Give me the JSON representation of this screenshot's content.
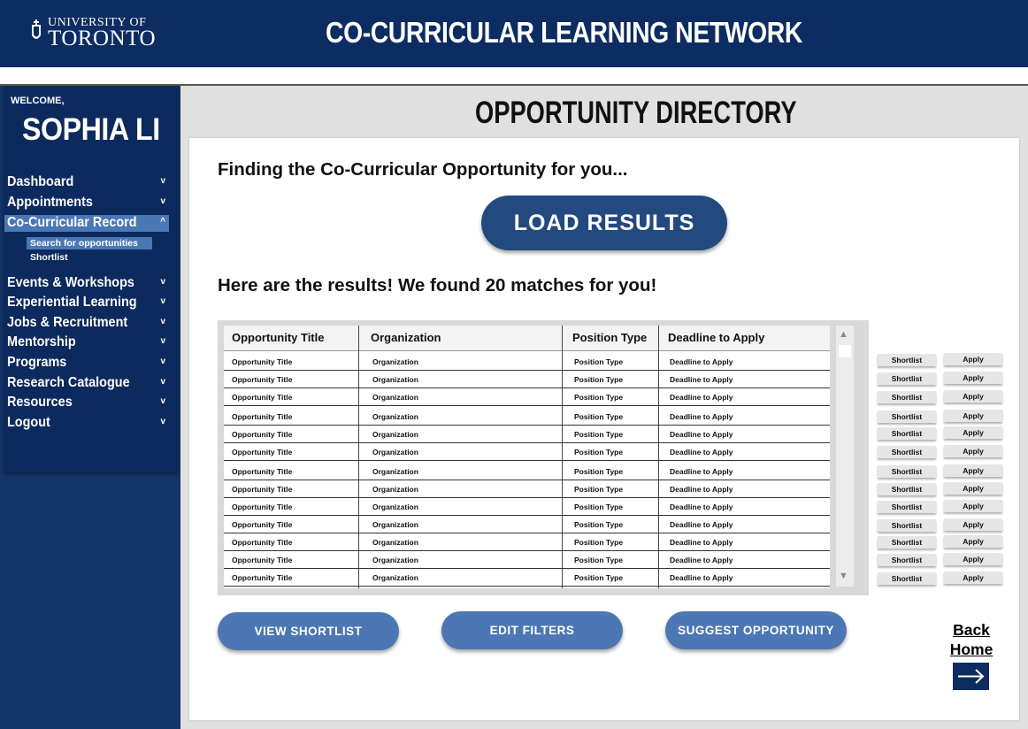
{
  "header": {
    "logo_line1": "UNIVERSITY OF",
    "logo_line2": "TORONTO",
    "title": "CO-CURRICULAR LEARNING NETWORK"
  },
  "sidebar": {
    "welcome": "WELCOME,",
    "user_name": "SOPHIA LI",
    "items": [
      {
        "label": "Dashboard",
        "chevron": "v"
      },
      {
        "label": "Appointments",
        "chevron": "v"
      },
      {
        "label": "Co-Curricular Record",
        "chevron": "^",
        "active": true
      },
      {
        "label": "Events & Workshops",
        "chevron": "v"
      },
      {
        "label": "Experiential Learning",
        "chevron": "v"
      },
      {
        "label": "Jobs & Recruitment",
        "chevron": "v"
      },
      {
        "label": "Mentorship",
        "chevron": "v"
      },
      {
        "label": "Programs",
        "chevron": "v"
      },
      {
        "label": "Research Catalogue",
        "chevron": "v"
      },
      {
        "label": "Resources",
        "chevron": "v"
      },
      {
        "label": "Logout",
        "chevron": "v"
      }
    ],
    "subitems": [
      {
        "label": "Search for opportunities",
        "active": true
      },
      {
        "label": "Shortlist",
        "active": false
      }
    ]
  },
  "main": {
    "page_title": "OPPORTUNITY DIRECTORY",
    "heading": "Finding the Co-Curricular Opportunity for you...",
    "load_button": "LOAD RESULTS",
    "results_heading": "Here are the results! We found 20 matches for you!",
    "table": {
      "columns": [
        "Opportunity Title",
        "Organization",
        "Position Type",
        "Deadline to Apply"
      ],
      "rows": [
        [
          "Opportunity Title",
          "Organization",
          "Position Type",
          "Deadline to Apply"
        ],
        [
          "Opportunity Title",
          "Organization",
          "Position Type",
          "Deadline to Apply"
        ],
        [
          "Opportunity Title",
          "Organization",
          "Position Type",
          "Deadline to Apply"
        ],
        [
          "Opportunity Title",
          "Organization",
          "Position Type",
          "Deadline to Apply"
        ],
        [
          "Opportunity Title",
          "Organization",
          "Position Type",
          "Deadline to Apply"
        ],
        [
          "Opportunity Title",
          "Organization",
          "Position Type",
          "Deadline to Apply"
        ],
        [
          "Opportunity Title",
          "Organization",
          "Position Type",
          "Deadline to Apply"
        ],
        [
          "Opportunity Title",
          "Organization",
          "Position Type",
          "Deadline to Apply"
        ],
        [
          "Opportunity Title",
          "Organization",
          "Position Type",
          "Deadline to Apply"
        ],
        [
          "Opportunity Title",
          "Organization",
          "Position Type",
          "Deadline to Apply"
        ],
        [
          "Opportunity Title",
          "Organization",
          "Position Type",
          "Deadline to Apply"
        ],
        [
          "Opportunity Title",
          "Organization",
          "Position Type",
          "Deadline to Apply"
        ],
        [
          "Opportunity Title",
          "Organization",
          "Position Type",
          "Deadline to Apply"
        ]
      ]
    },
    "row_actions": {
      "shortlist": "Shortlist",
      "apply": "Apply"
    },
    "buttons": {
      "view_shortlist": "VIEW SHORTLIST",
      "edit_filters": "EDIT FILTERS",
      "suggest": "SUGGEST OPPORTUNITY"
    },
    "back_home": {
      "line1": "Back",
      "line2": "Home"
    }
  },
  "colors": {
    "brand_navy": "#0d2c62",
    "accent_blue": "#4c77b4",
    "load_button": "#234a7f"
  }
}
